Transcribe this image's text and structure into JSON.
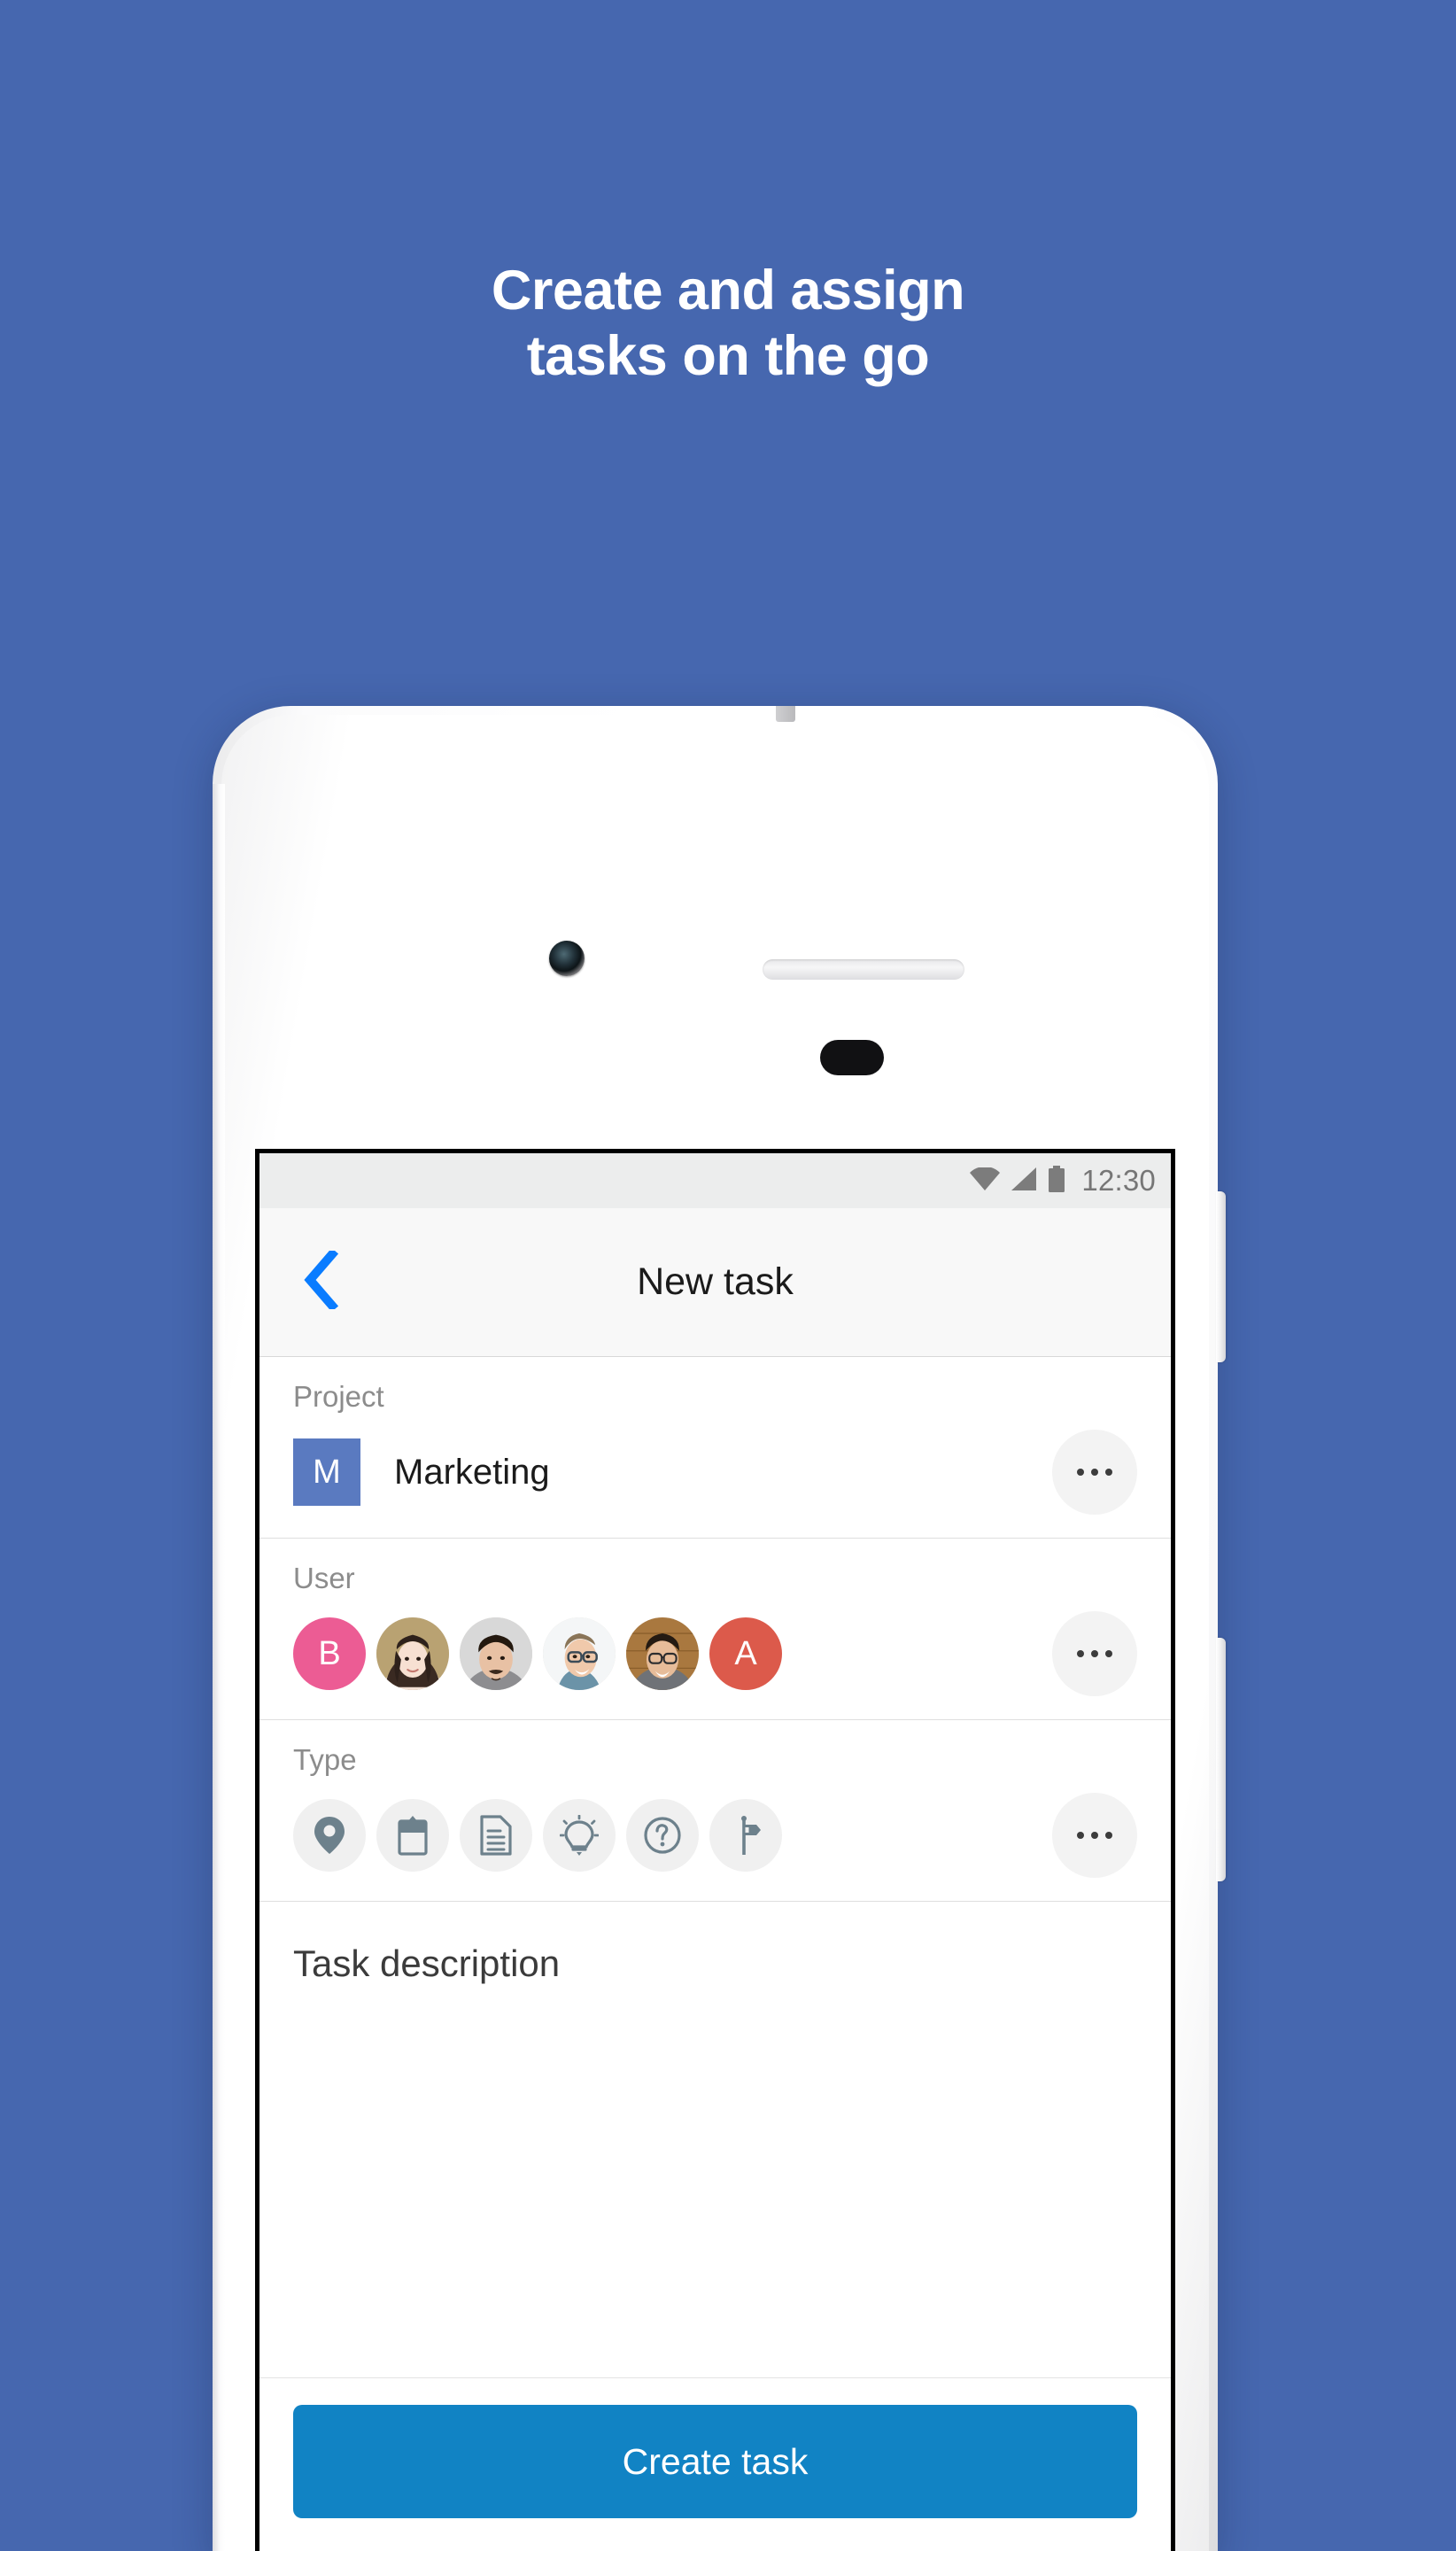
{
  "background_color": "#4667af",
  "headline": {
    "line1": "Create and assign",
    "line2": "tasks on the go"
  },
  "phone": {
    "hardware": {
      "front_camera": "front-camera",
      "earpiece_speaker": "speaker-grille",
      "proximity_sensor": "proximity-sensor",
      "power_button": "power-button",
      "volume_button": "volume-button",
      "antenna_line": "antenna-band"
    }
  },
  "status_bar": {
    "wifi_icon": "wifi-icon",
    "signal_icon": "signal-icon",
    "battery_icon": "battery-icon",
    "time": "12:30"
  },
  "app_bar": {
    "back_icon": "back-chevron-icon",
    "title": "New task",
    "accent_color": "#0a7cff"
  },
  "project_section": {
    "label": "Project",
    "avatar_initial": "M",
    "avatar_color": "#5a7ac0",
    "name": "Marketing",
    "more_label": "more-options"
  },
  "user_section": {
    "label": "User",
    "avatars": [
      {
        "type": "initial",
        "initial": "B",
        "color": "#ec5c94",
        "name": "avatar-b"
      },
      {
        "type": "photo",
        "name": "avatar-photo-1"
      },
      {
        "type": "photo",
        "name": "avatar-photo-2"
      },
      {
        "type": "photo",
        "name": "avatar-photo-3"
      },
      {
        "type": "photo",
        "name": "avatar-photo-4"
      },
      {
        "type": "initial",
        "initial": "A",
        "color": "#dc5a4b",
        "name": "avatar-a"
      }
    ],
    "more_label": "more-options"
  },
  "type_section": {
    "label": "Type",
    "icons": [
      "location-pin-icon",
      "clipboard-icon",
      "document-icon",
      "lightbulb-icon",
      "question-mark-icon",
      "signpost-icon"
    ],
    "more_label": "more-options"
  },
  "description_section": {
    "placeholder": "Task description",
    "value": ""
  },
  "cta": {
    "label": "Create task",
    "color": "#1183c4"
  }
}
